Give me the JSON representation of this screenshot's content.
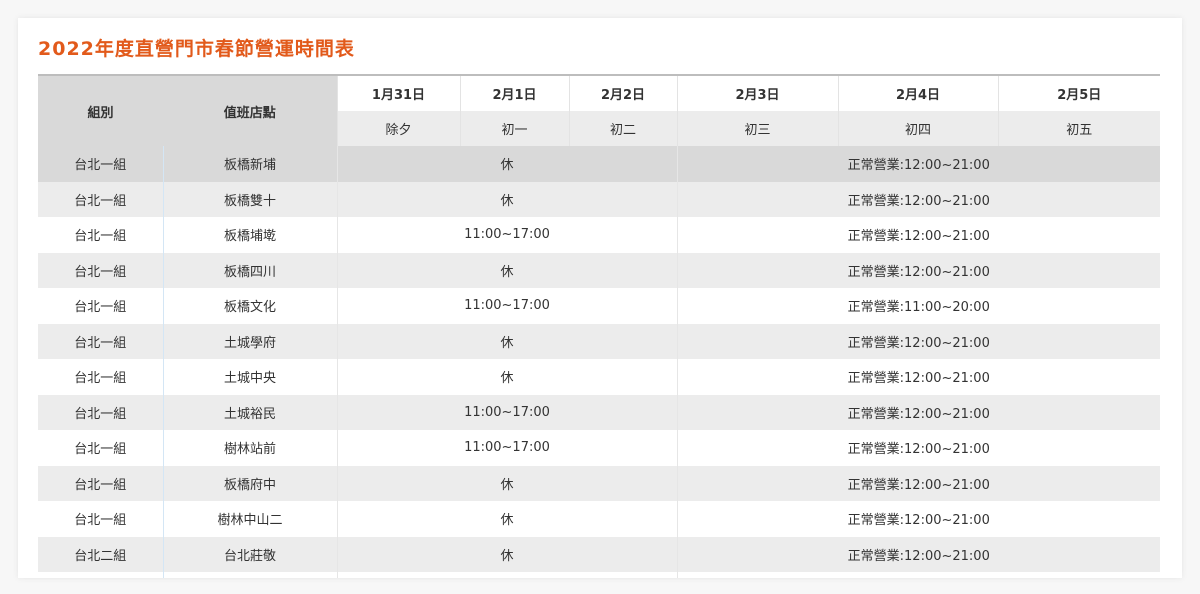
{
  "page": {
    "title": "2022年度直營門市春節營運時間表"
  },
  "table": {
    "col_group": "組別",
    "col_store": "值班店點",
    "dates": [
      {
        "date": "1月31日",
        "lunar": "除夕"
      },
      {
        "date": "2月1日",
        "lunar": "初一"
      },
      {
        "date": "2月2日",
        "lunar": "初二"
      },
      {
        "date": "2月3日",
        "lunar": "初三"
      },
      {
        "date": "2月4日",
        "lunar": "初四"
      },
      {
        "date": "2月5日",
        "lunar": "初五"
      }
    ],
    "rows": [
      {
        "group": "台北一組",
        "store": "板橋新埔",
        "early": "休",
        "normal": "正常營業:12:00~21:00"
      },
      {
        "group": "台北一組",
        "store": "板橋雙十",
        "early": "休",
        "normal": "正常營業:12:00~21:00"
      },
      {
        "group": "台北一組",
        "store": "板橋埔墘",
        "early": "11:00~17:00",
        "normal": "正常營業:12:00~21:00"
      },
      {
        "group": "台北一組",
        "store": "板橋四川",
        "early": "休",
        "normal": "正常營業:12:00~21:00"
      },
      {
        "group": "台北一組",
        "store": "板橋文化",
        "early": "11:00~17:00",
        "normal": "正常營業:11:00~20:00"
      },
      {
        "group": "台北一組",
        "store": "土城學府",
        "early": "休",
        "normal": "正常營業:12:00~21:00"
      },
      {
        "group": "台北一組",
        "store": "土城中央",
        "early": "休",
        "normal": "正常營業:12:00~21:00"
      },
      {
        "group": "台北一組",
        "store": "土城裕民",
        "early": "11:00~17:00",
        "normal": "正常營業:12:00~21:00"
      },
      {
        "group": "台北一組",
        "store": "樹林站前",
        "early": "11:00~17:00",
        "normal": "正常營業:12:00~21:00"
      },
      {
        "group": "台北一組",
        "store": "板橋府中",
        "early": "休",
        "normal": "正常營業:12:00~21:00"
      },
      {
        "group": "台北一組",
        "store": "樹林中山二",
        "early": "休",
        "normal": "正常營業:12:00~21:00"
      },
      {
        "group": "台北二組",
        "store": "台北莊敬",
        "early": "休",
        "normal": "正常營業:12:00~21:00"
      },
      {
        "group": "",
        "store": "",
        "early": "",
        "normal": ""
      }
    ]
  },
  "colors": {
    "title": "#e25a1b",
    "header_gray": "#d9d9d9",
    "row_gray": "#ececec",
    "row_white": "#ffffff"
  }
}
